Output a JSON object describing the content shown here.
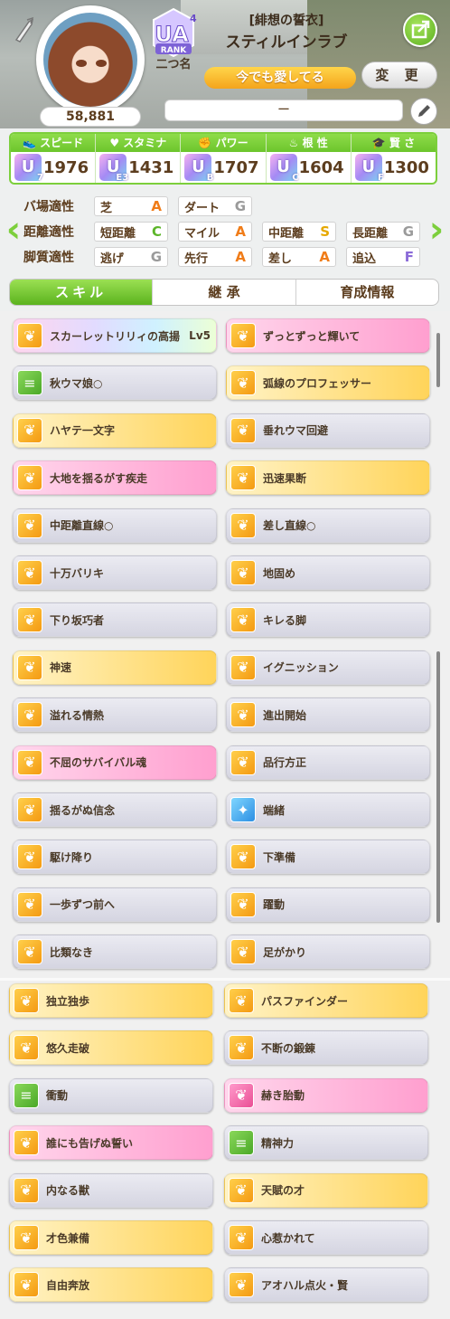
{
  "header": {
    "points": "58,881",
    "rank": "UA",
    "rank_sub": "4",
    "rank_label": "RANK",
    "rank_name": "二つ名",
    "alias": "[緋想の誓衣]",
    "character": "スティルインラブ",
    "title": "今でも愛してる",
    "change_label": "変 更",
    "comment": "ー"
  },
  "stats": [
    {
      "label": "スピード",
      "icon": "shoe-icon",
      "grade": "U",
      "sub": "7",
      "value": "1976"
    },
    {
      "label": "スタミナ",
      "icon": "heart-icon",
      "grade": "U",
      "sub": "E3",
      "value": "1431"
    },
    {
      "label": "パワー",
      "icon": "muscle-icon",
      "grade": "U",
      "sub": "B",
      "value": "1707"
    },
    {
      "label": "根 性",
      "icon": "flame-icon",
      "grade": "U",
      "sub": "C",
      "value": "1604"
    },
    {
      "label": "賢 さ",
      "icon": "cap-icon",
      "grade": "U",
      "sub": "F",
      "value": "1300"
    }
  ],
  "aptitude": {
    "track_label": "バ場適性",
    "distance_label": "距離適性",
    "style_label": "脚質適性",
    "track": [
      {
        "name": "芝",
        "grade": "A",
        "color": "#f07c18"
      },
      {
        "name": "ダート",
        "grade": "G",
        "color": "#9a9a9a"
      }
    ],
    "distance": [
      {
        "name": "短距離",
        "grade": "C",
        "color": "#5cb52a"
      },
      {
        "name": "マイル",
        "grade": "A",
        "color": "#f07c18"
      },
      {
        "name": "中距離",
        "grade": "S",
        "color": "#e6a800"
      },
      {
        "name": "長距離",
        "grade": "G",
        "color": "#9a9a9a"
      }
    ],
    "style": [
      {
        "name": "逃げ",
        "grade": "G",
        "color": "#9a9a9a"
      },
      {
        "name": "先行",
        "grade": "A",
        "color": "#f07c18"
      },
      {
        "name": "差し",
        "grade": "A",
        "color": "#f07c18"
      },
      {
        "name": "追込",
        "grade": "F",
        "color": "#8a6ad8"
      }
    ]
  },
  "tabs": [
    "スキル",
    "継 承",
    "育成情報"
  ],
  "skills": [
    {
      "name": "スカーレットリリィの高揚",
      "level": "Lv5",
      "style": "rainbow",
      "icon": "speed"
    },
    {
      "name": "ずっとずっと輝いて",
      "style": "pink",
      "icon": "speed"
    },
    {
      "name": "秋ウマ娘○",
      "style": "normal",
      "icon": "green"
    },
    {
      "name": "弧線のプロフェッサー",
      "style": "gold",
      "icon": "speed"
    },
    {
      "name": "ハヤテ一文字",
      "style": "gold",
      "icon": "speed"
    },
    {
      "name": "垂れウマ回避",
      "style": "normal",
      "icon": "speed"
    },
    {
      "name": "大地を揺るがす疾走",
      "style": "pink",
      "icon": "speed"
    },
    {
      "name": "迅速果断",
      "style": "gold",
      "icon": "speed"
    },
    {
      "name": "中距離直線○",
      "style": "normal",
      "icon": "speed"
    },
    {
      "name": "差し直線○",
      "style": "normal",
      "icon": "speed"
    },
    {
      "name": "十万バリキ",
      "style": "normal",
      "icon": "speed"
    },
    {
      "name": "地固め",
      "style": "normal",
      "icon": "speed"
    },
    {
      "name": "下り坂巧者",
      "style": "normal",
      "icon": "speed"
    },
    {
      "name": "キレる脚",
      "style": "normal",
      "icon": "speed"
    },
    {
      "name": "神速",
      "style": "gold",
      "icon": "speed"
    },
    {
      "name": "イグニッション",
      "style": "normal",
      "icon": "speed"
    },
    {
      "name": "溢れる情熱",
      "style": "normal",
      "icon": "speed"
    },
    {
      "name": "進出開始",
      "style": "normal",
      "icon": "speed"
    },
    {
      "name": "不屈のサバイバル魂",
      "style": "pink",
      "icon": "speed"
    },
    {
      "name": "品行方正",
      "style": "normal",
      "icon": "speed"
    },
    {
      "name": "揺るがぬ信念",
      "style": "normal",
      "icon": "speed"
    },
    {
      "name": "端緒",
      "style": "normal",
      "icon": "blue"
    },
    {
      "name": "駆け降り",
      "style": "normal",
      "icon": "speed"
    },
    {
      "name": "下準備",
      "style": "normal",
      "icon": "speed"
    },
    {
      "name": "一歩ずつ前へ",
      "style": "normal",
      "icon": "speed"
    },
    {
      "name": "躍動",
      "style": "normal",
      "icon": "speed"
    },
    {
      "name": "比類なき",
      "style": "normal",
      "icon": "speed"
    },
    {
      "name": "足がかり",
      "style": "normal",
      "icon": "speed"
    },
    {
      "name": "独立独歩",
      "style": "gold",
      "icon": "speed"
    },
    {
      "name": "パスファインダー",
      "style": "gold",
      "icon": "speed"
    },
    {
      "name": "悠久走破",
      "style": "gold",
      "icon": "speed"
    },
    {
      "name": "不断の鍛錬",
      "style": "normal",
      "icon": "speed"
    },
    {
      "name": "衝動",
      "style": "normal",
      "icon": "green"
    },
    {
      "name": "赫き胎動",
      "style": "pink",
      "icon": "pinkic"
    },
    {
      "name": "誰にも告げぬ誓い",
      "style": "pink",
      "icon": "speed"
    },
    {
      "name": "精神力",
      "style": "normal",
      "icon": "green"
    },
    {
      "name": "内なる獣",
      "style": "normal",
      "icon": "speed"
    },
    {
      "name": "天賦の才",
      "style": "gold",
      "icon": "speed"
    },
    {
      "name": "才色兼備",
      "style": "gold",
      "icon": "speed"
    },
    {
      "name": "心惹かれて",
      "style": "normal",
      "icon": "speed"
    },
    {
      "name": "自由奔放",
      "style": "gold",
      "icon": "speed"
    },
    {
      "name": "アオハル点火・賢",
      "style": "normal",
      "icon": "speed"
    }
  ]
}
